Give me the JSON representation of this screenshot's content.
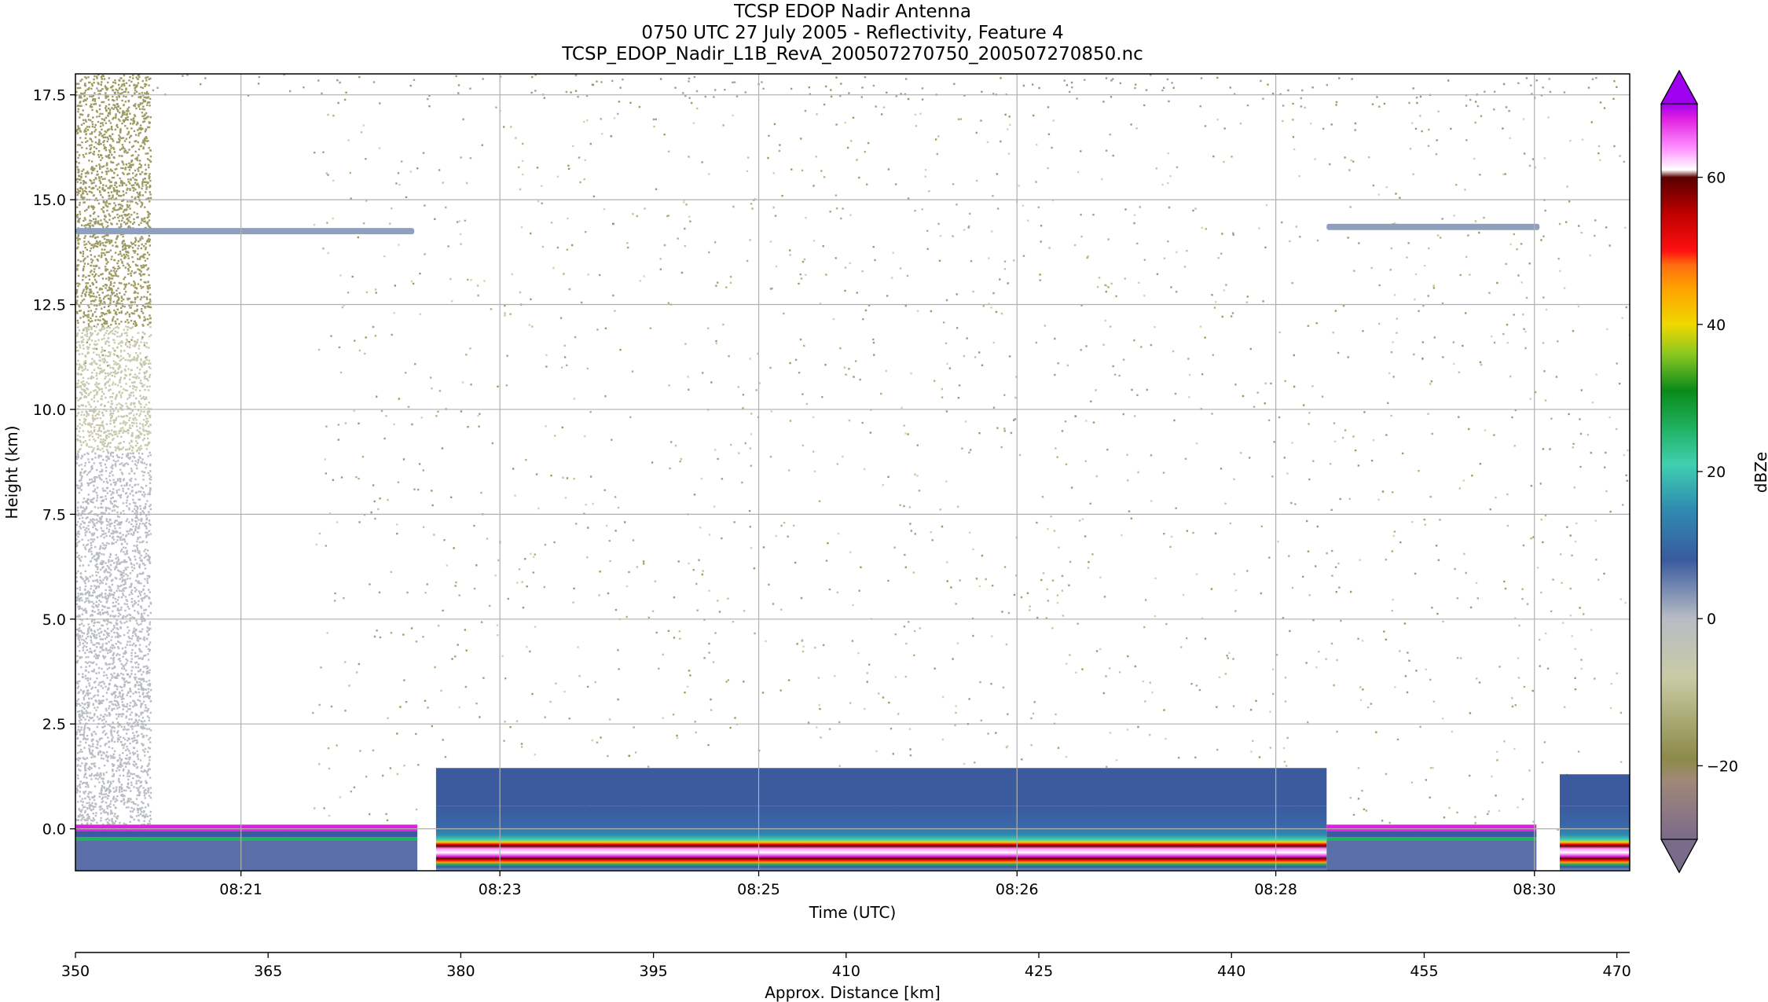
{
  "chart_data": {
    "type": "heatmap",
    "title": "TCSP EDOP Nadir Antenna",
    "subtitle": "0750 UTC 27 July 2005 - Reflectivity, Feature 4",
    "filename": "TCSP_EDOP_Nadir_L1B_RevA_200507270750_200507270850.nc",
    "xlabel": "Time (UTC)",
    "ylabel": "Height (km)",
    "x2label": "Approx. Distance [km]",
    "colorbar_label": "dBZe",
    "x_time_ticks": [
      "08:21",
      "08:23",
      "08:25",
      "08:26",
      "08:28",
      "08:30"
    ],
    "x_time_tick_fracs": [
      0.1065,
      0.2731,
      0.4396,
      0.6058,
      0.7723,
      0.9387
    ],
    "x_distance_ticks": [
      350,
      365,
      380,
      395,
      410,
      425,
      440,
      455,
      470
    ],
    "x_distance_range": [
      350,
      471
    ],
    "y_ticks": [
      "0.0",
      "2.5",
      "5.0",
      "7.5",
      "10.0",
      "12.5",
      "15.0",
      "17.5"
    ],
    "ylim": [
      -1.0,
      18.0
    ],
    "colorbar_ticks": [
      "−20",
      "0",
      "20",
      "40",
      "60"
    ],
    "colorbar_range": [
      -30,
      70
    ],
    "colorbar_extend": "both",
    "colorbar_stops": [
      {
        "v": -30,
        "c": "#7a6b8a"
      },
      {
        "v": -22,
        "c": "#a08878"
      },
      {
        "v": -19,
        "c": "#8c8a48"
      },
      {
        "v": -8,
        "c": "#c9cba6"
      },
      {
        "v": 0,
        "c": "#b8bcc4"
      },
      {
        "v": 8,
        "c": "#3a5aa0"
      },
      {
        "v": 15,
        "c": "#2f8cb0"
      },
      {
        "v": 21,
        "c": "#40d0b0"
      },
      {
        "v": 26,
        "c": "#20b060"
      },
      {
        "v": 31,
        "c": "#0a8a1a"
      },
      {
        "v": 36,
        "c": "#8cc820"
      },
      {
        "v": 40,
        "c": "#f0d800"
      },
      {
        "v": 45,
        "c": "#ffa000"
      },
      {
        "v": 48,
        "c": "#ff7010"
      },
      {
        "v": 50,
        "c": "#ff1010"
      },
      {
        "v": 55,
        "c": "#c00000"
      },
      {
        "v": 58,
        "c": "#800000"
      },
      {
        "v": 60,
        "c": "#5a0000"
      },
      {
        "v": 61,
        "c": "#ffffff"
      },
      {
        "v": 64,
        "c": "#ff90ff"
      },
      {
        "v": 68,
        "c": "#e020e0"
      },
      {
        "v": 70,
        "c": "#a000f0"
      }
    ],
    "features": {
      "upper_echo_segments": [
        {
          "x0": 0.0,
          "x1": 0.218,
          "height_km": 14.25
        },
        {
          "x0": 0.805,
          "x1": 0.942,
          "height_km": 14.35
        }
      ],
      "surface_band_top_km": [
        {
          "x0": 0.0,
          "x1": 0.22,
          "top_km": 0.1
        },
        {
          "x0": 0.232,
          "x1": 0.805,
          "top_km": 1.45
        },
        {
          "x0": 0.805,
          "x1": 0.94,
          "top_km": 0.1
        },
        {
          "x0": 0.955,
          "x1": 1.0,
          "top_km": 1.3
        }
      ],
      "surface_height_km": 0.0,
      "data_gap": {
        "x0": 0.048,
        "x1": 0.152,
        "bottom_km": 0.1,
        "top_km": 17.5
      }
    }
  }
}
